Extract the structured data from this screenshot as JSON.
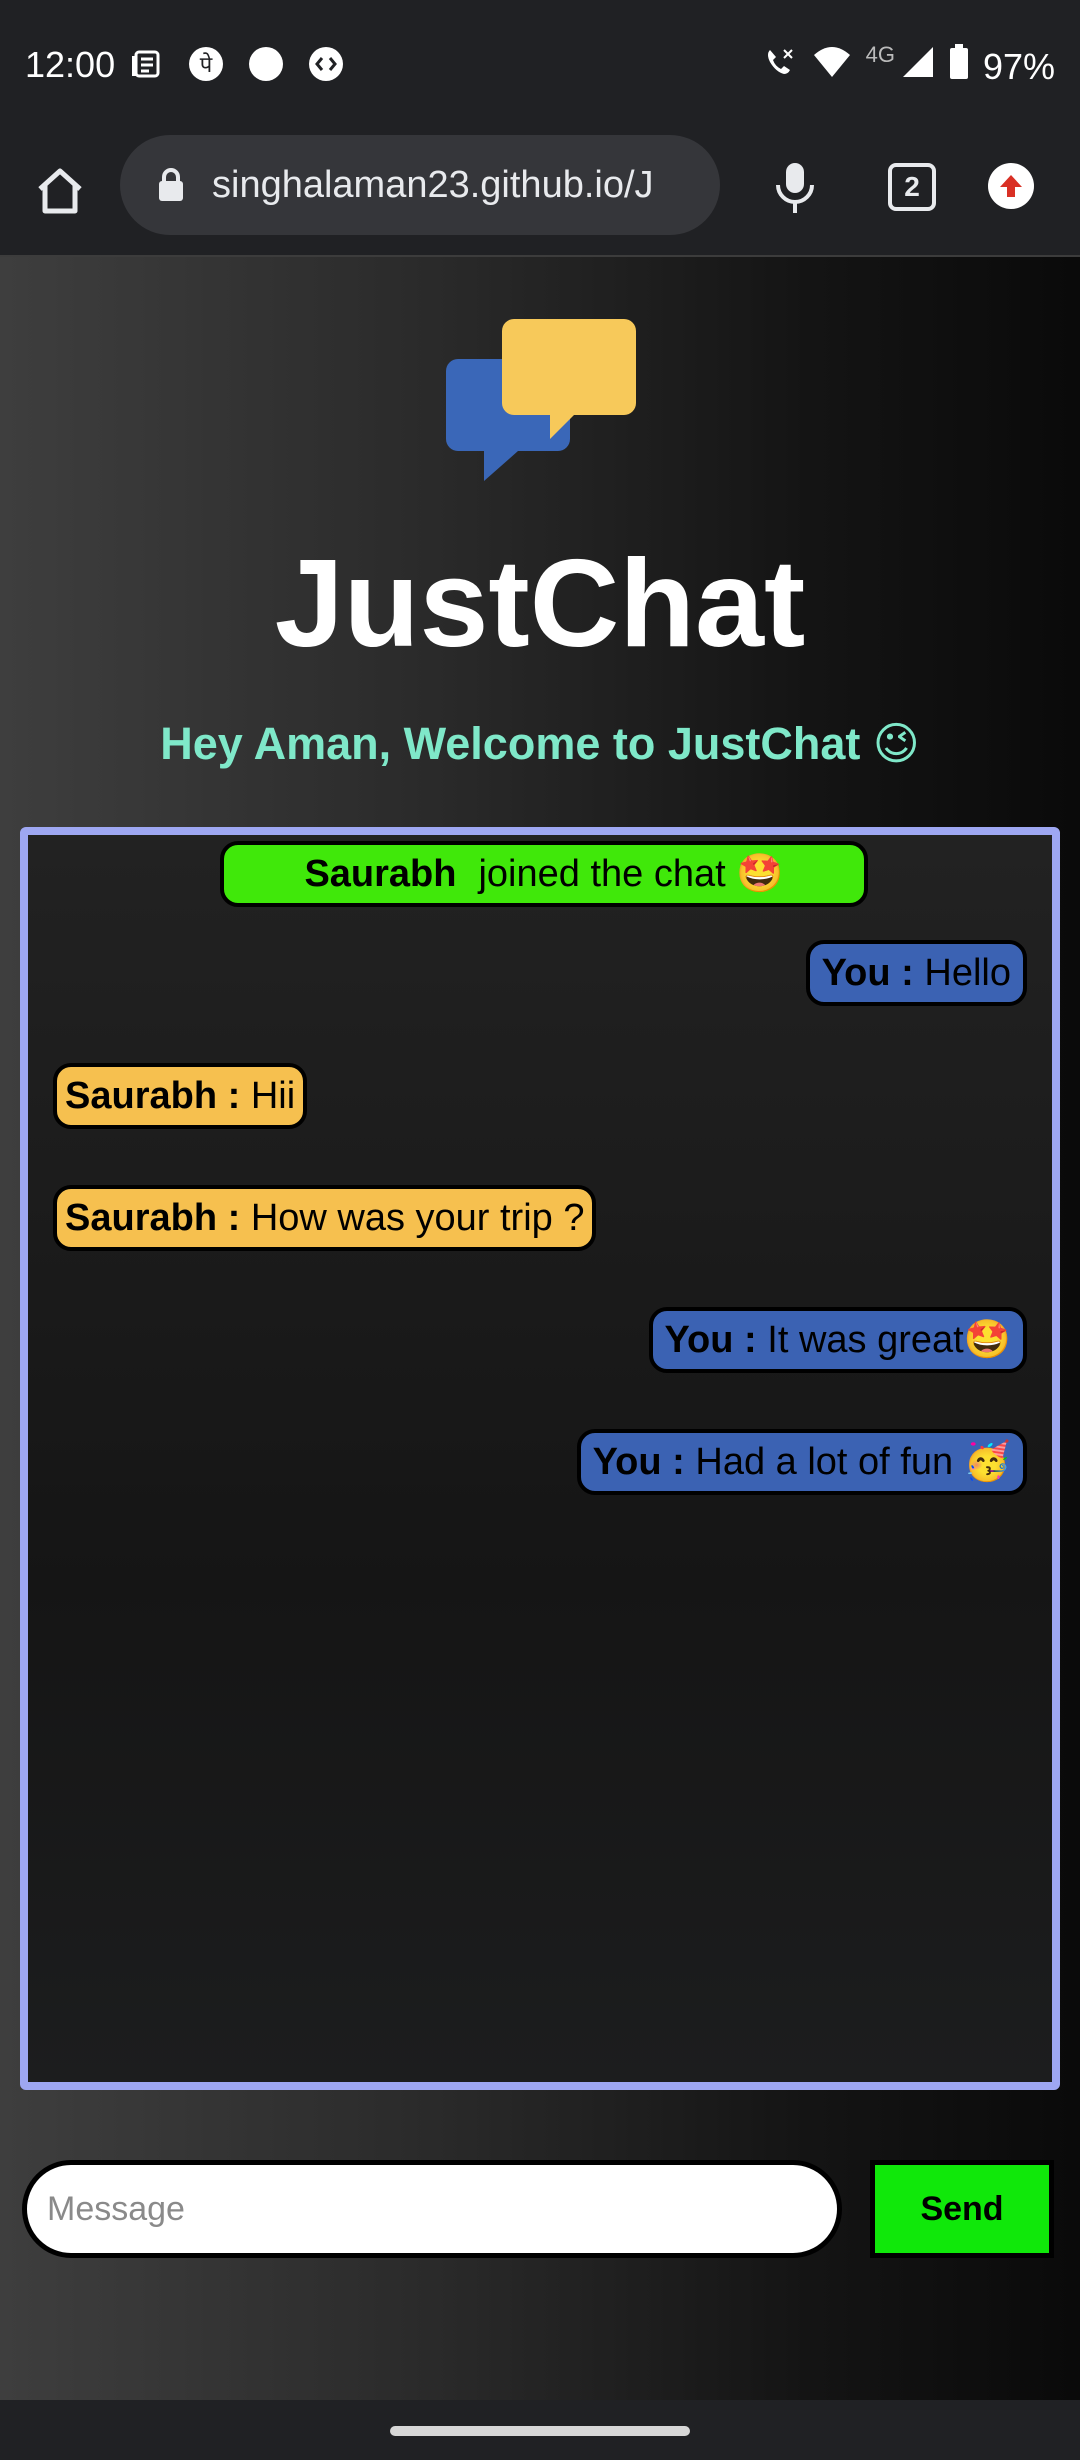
{
  "status_bar": {
    "time": "12:00",
    "network_type": "4G",
    "battery": "97%",
    "icons": [
      "news-icon",
      "pe-icon",
      "circle-icon",
      "shazam-icon",
      "call-icon",
      "wifi-icon",
      "signal-icon",
      "battery-icon"
    ]
  },
  "browser": {
    "url": "singhalaman23.github.io/J",
    "tab_count": "2"
  },
  "app": {
    "title": "JustChat",
    "welcome": "Hey Aman, Welcome to JustChat 😉"
  },
  "chat": {
    "join": {
      "name": "Saurabh",
      "text": "joined the chat 🤩"
    },
    "messages": [
      {
        "sender": "You :",
        "text": "Hello",
        "side": "right"
      },
      {
        "sender": "Saurabh  :",
        "text": "Hii",
        "side": "left"
      },
      {
        "sender": "Saurabh  :",
        "text": "How was your trip ?",
        "side": "left"
      },
      {
        "sender": "You :",
        "text": "It was great🤩",
        "side": "right"
      },
      {
        "sender": "You :",
        "text": "Had a lot of fun 🥳",
        "side": "right"
      }
    ]
  },
  "composer": {
    "placeholder": "Message",
    "send_label": "Send"
  },
  "colors": {
    "you_bubble": "#3b62b3",
    "other_bubble": "#f6c04f",
    "join_bubble": "#40e80a",
    "send_button": "#10e80a",
    "welcome_text": "#7fe8c9"
  }
}
